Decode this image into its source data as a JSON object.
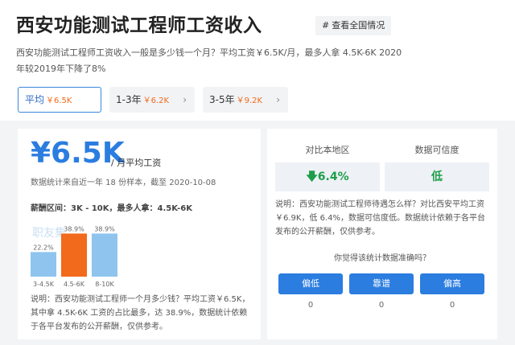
{
  "header": {
    "title": "西安功能测试工程师工资收入",
    "tag_hash": "#",
    "tag_label": "查看全国情况"
  },
  "description": "西安功能测试工程师工资收入一般是多少钱一个月？平均工资￥6.5K/月，最多人拿 4.5K-6K 2020年较2019年下降了8%",
  "tabs": [
    {
      "label": "平均",
      "value": "￥6.5K",
      "active": true
    },
    {
      "label": "1-3年",
      "value": "￥6.2K",
      "active": false
    },
    {
      "label": "3-5年",
      "value": "￥9.2K",
      "active": false
    }
  ],
  "salary": {
    "amount": "¥6.5K",
    "unit": "/ 月平均工资",
    "source": "数据统计来自近一年 18 份样本，截至 2020-10-08",
    "range": "薪酬区间：3K - 10K，最多人拿：4.5K-6K"
  },
  "watermark": "职友集",
  "chart_data": {
    "type": "bar",
    "categories": [
      "3-4.5K",
      "4.5-6K",
      "8-10K"
    ],
    "values": [
      22.2,
      38.9,
      38.9
    ],
    "value_labels": [
      "22.2%",
      "38.9%",
      "38.9%"
    ],
    "colors": [
      "#8ec4ee",
      "#f26a1b",
      "#8ec4ee"
    ],
    "ylim": [
      0,
      45
    ]
  },
  "left_explain": "说明：西安功能测试工程师一个月多少钱？平均工资￥6.5K，其中拿 4.5K-6K 工资的占比最多，达 38.9%，数据统计依赖于各平台发布的公开薪酬，仅供参考。",
  "compare": {
    "region_label": "对比本地区",
    "region_value": "6.4%",
    "region_arrow": "🡇",
    "trust_label": "数据可信度",
    "trust_value": "低",
    "color_up": "#1e9e4a"
  },
  "right_explain": "说明：西安功能测试工程师待遇怎么样？对比西安平均工资￥6.9K，低 6.4%，数据可信度低。数据统计依赖于各平台发布的公开薪酬，仅供参考。",
  "vote": {
    "question": "你觉得该统计数据准确吗？",
    "options": [
      {
        "label": "偏低",
        "count": "0"
      },
      {
        "label": "靠谱",
        "count": "0"
      },
      {
        "label": "偏高",
        "count": "0"
      }
    ]
  }
}
